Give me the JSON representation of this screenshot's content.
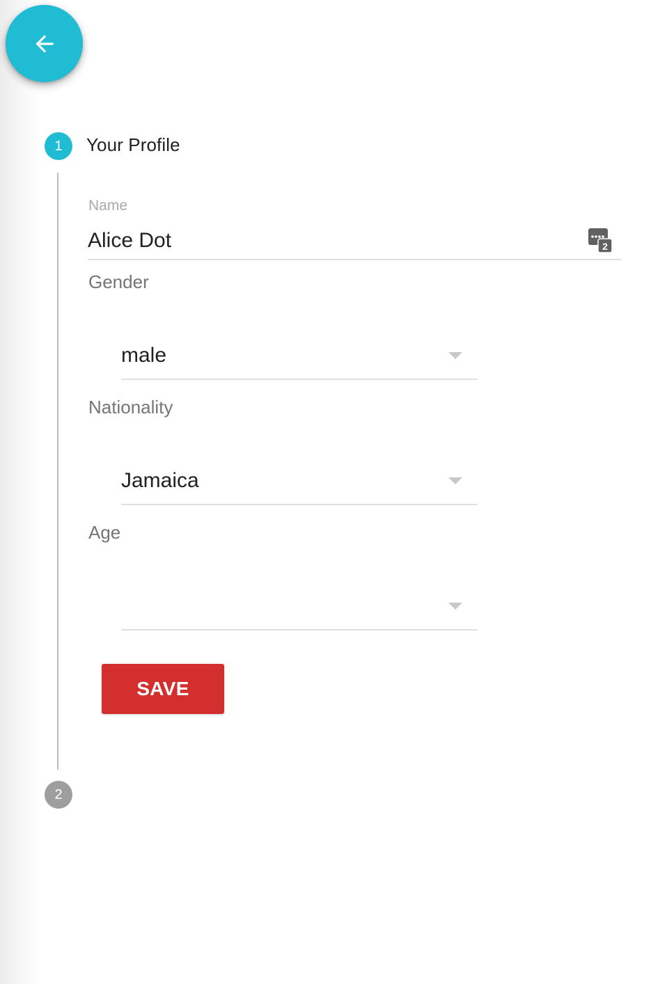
{
  "fab": {
    "icon": "arrow-left-icon"
  },
  "steps": [
    {
      "number": "1",
      "title": "Your Profile",
      "state": "active"
    },
    {
      "number": "2",
      "title": "",
      "state": "inactive"
    }
  ],
  "form": {
    "name": {
      "label": "Name",
      "value": "Alice Dot",
      "trailing_icon": "password-manager-icon",
      "icon_badge": "2"
    },
    "gender": {
      "label": "Gender",
      "value": "male"
    },
    "nationality": {
      "label": "Nationality",
      "value": "Jamaica"
    },
    "age": {
      "label": "Age",
      "value": ""
    },
    "save_label": "SAVE"
  },
  "colors": {
    "accent": "#1fbcd4",
    "save_button": "#d32f2f",
    "inactive_step": "#9e9e9e"
  }
}
